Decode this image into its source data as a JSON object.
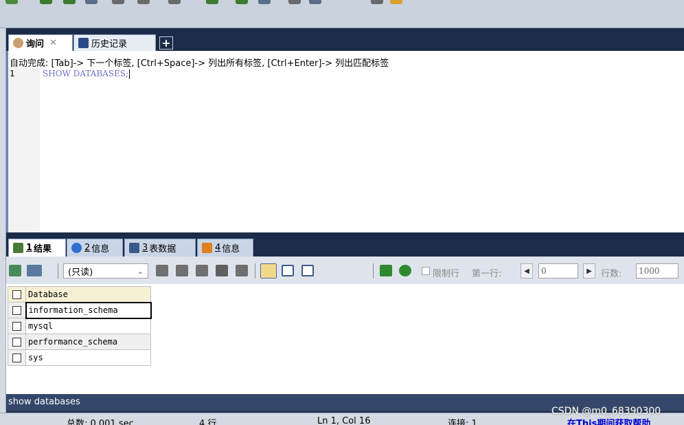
{
  "query_tabs": [
    {
      "label": "询问",
      "active": true
    },
    {
      "label": "历史记录",
      "active": false
    }
  ],
  "add_tab_symbol": "+",
  "editor": {
    "autocomplete_hint": "自动完成: [Tab]-> 下一个标签, [Ctrl+Space]-> 列出所有标签, [Ctrl+Enter]-> 列出匹配标签",
    "line_number": "1",
    "code": "SHOW DATABASES;"
  },
  "result_tabs": [
    {
      "num": "1",
      "label": "结果",
      "active": true
    },
    {
      "num": "2",
      "label": "信息",
      "active": false
    },
    {
      "num": "3",
      "label": "表数据",
      "active": false
    },
    {
      "num": "4",
      "label": "信息",
      "active": false
    }
  ],
  "result_toolbar": {
    "readonly_select": "(只读)",
    "limit_rows_label": "限制行",
    "first_row_label": "第一行:",
    "first_row_value": "0",
    "row_count_label": "行数:",
    "row_count_value": "1000"
  },
  "result_grid": {
    "header": "Database",
    "rows": [
      "information_schema",
      "mysql",
      "performance_schema",
      "sys"
    ]
  },
  "sql_status": "show databases",
  "status_bar": {
    "total_time": "总数: 0.001 sec",
    "rows": "4 行",
    "cursor": "Ln 1, Col 16",
    "connections": "连接: 1",
    "help": "在This期间获取帮助"
  },
  "watermark": "CSDN @m0_68390300",
  "colors": {
    "panel_bg": "#1c2b47",
    "status_strip": "#34476a",
    "help_link": "#0000cc"
  }
}
